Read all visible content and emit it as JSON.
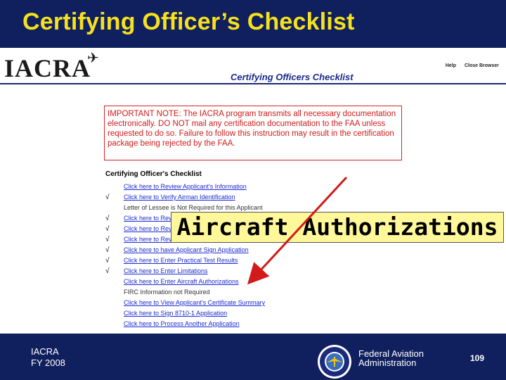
{
  "slide": {
    "title": "Certifying Officer’s Checklist",
    "footer_org": "IACRA",
    "footer_year": "FY 2008",
    "agency_line1": "Federal Aviation",
    "agency_line2": "Administration",
    "page_number": "109"
  },
  "app": {
    "logo": "IACRA",
    "title": "Certifying Officers Checklist",
    "help_link": "Help",
    "close_link": "Close Browser",
    "important_note": "IMPORTANT NOTE: The IACRA program transmits all necessary documentation electronically. DO NOT mail any certification documentation to the FAA unless requested to do so. Failure to follow this instruction may result in the certification package being rejected by the FAA.",
    "steps_heading": "Certifying Officer's Checklist",
    "steps": [
      {
        "checked": "",
        "text": "Click here to Review Applicant's Information",
        "link": true
      },
      {
        "checked": "√",
        "text": "Click here to Verify Airman Identification",
        "link": true
      },
      {
        "checked": "",
        "text": "Letter of Lessee is Not Required for this Applicant",
        "link": false
      },
      {
        "checked": "√",
        "text": "Click here to Review Airman Knowledge Test Report",
        "link": true
      },
      {
        "checked": "√",
        "text": "Click here to Review 8710-1 Application",
        "link": true
      },
      {
        "checked": "√",
        "text": "Click here to Review Privacy Act Statement",
        "link": true
      },
      {
        "checked": "√",
        "text": "Click here to have Applicant Sign Application",
        "link": true
      },
      {
        "checked": "√",
        "text": "Click here to Enter Practical Test Results",
        "link": true
      },
      {
        "checked": "√",
        "text": "Click here to Enter Limitations",
        "link": true
      },
      {
        "checked": "",
        "text": "Click here to Enter Aircraft Authorizations",
        "link": true
      },
      {
        "checked": "",
        "text": "FIRC Information not Required",
        "link": false
      },
      {
        "checked": "",
        "text": "Click here to View Applicant's Certificate Summary",
        "link": true
      },
      {
        "checked": "",
        "text": "Click here to Sign 8710-1 Application",
        "link": true
      },
      {
        "checked": "",
        "text": "Click here to Process Another Application",
        "link": true
      }
    ]
  },
  "callout": {
    "label": "Aircraft Authorizations"
  },
  "colors": {
    "slide_bg": "#10205e",
    "title_yellow": "#f7e11c",
    "note_red": "#d21a1a",
    "link_blue": "#1a2ad0",
    "callout_bg": "#fff89a",
    "arrow_red": "#d21a1a"
  },
  "icons": {
    "plane": "airplane-icon",
    "seal": "faa-seal-icon",
    "check": "checkmark-icon"
  }
}
